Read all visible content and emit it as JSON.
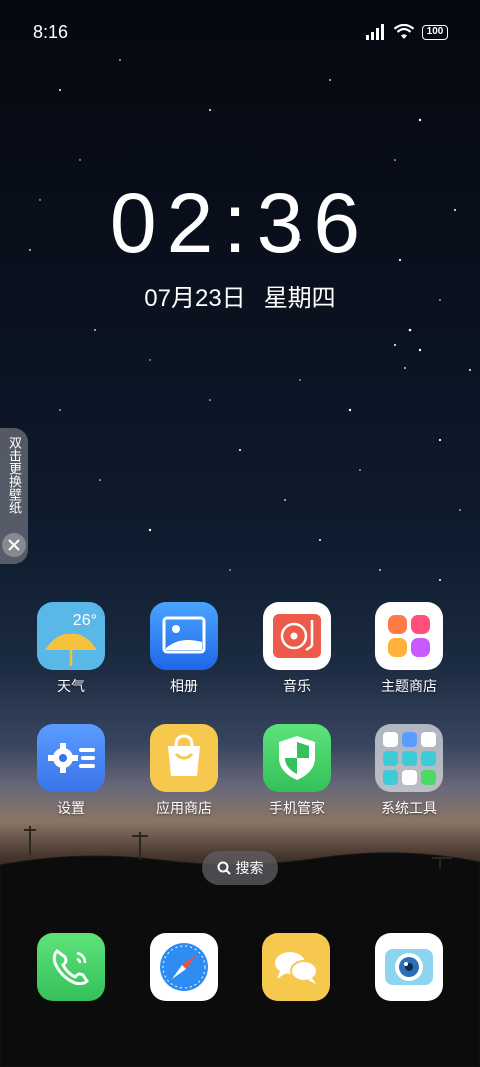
{
  "status_bar": {
    "time": "8:16",
    "battery": "100",
    "icons": [
      "signal-icon",
      "wifi-icon",
      "battery-icon"
    ]
  },
  "clock": {
    "time": "02:36",
    "date": "07月23日",
    "weekday": "星期四"
  },
  "side_tab": {
    "label": "双击更换壁纸",
    "close_icon": "close-icon"
  },
  "apps": {
    "row1": [
      {
        "label": "天气",
        "temp": "26°",
        "icon": "weather-icon"
      },
      {
        "label": "相册",
        "icon": "gallery-icon"
      },
      {
        "label": "音乐",
        "icon": "music-icon"
      },
      {
        "label": "主题商店",
        "icon": "theme-store-icon"
      }
    ],
    "row2": [
      {
        "label": "设置",
        "icon": "settings-icon"
      },
      {
        "label": "应用商店",
        "icon": "app-store-icon"
      },
      {
        "label": "手机管家",
        "icon": "phone-manager-icon"
      },
      {
        "label": "系统工具",
        "icon": "system-tools-folder-icon"
      }
    ]
  },
  "search": {
    "label": "搜索",
    "icon": "search-icon"
  },
  "dock": [
    {
      "name": "phone",
      "icon": "phone-icon"
    },
    {
      "name": "browser",
      "icon": "compass-icon"
    },
    {
      "name": "messages",
      "icon": "messages-icon"
    },
    {
      "name": "camera",
      "icon": "camera-icon"
    }
  ],
  "colors": {
    "weather_bg": "#5ab8e8",
    "gallery_bg": "#2f7cf2",
    "music_bg": "#ffffff",
    "theme_store_bg": "#ffffff",
    "settings_bg": "#4a8cf0",
    "app_store_bg": "#f6c84e",
    "phone_manager_bg": "#4cd964",
    "folder_bg": "#c8ccd4",
    "phone_bg": "#4cd964",
    "messages_bg": "#f6c84e"
  }
}
